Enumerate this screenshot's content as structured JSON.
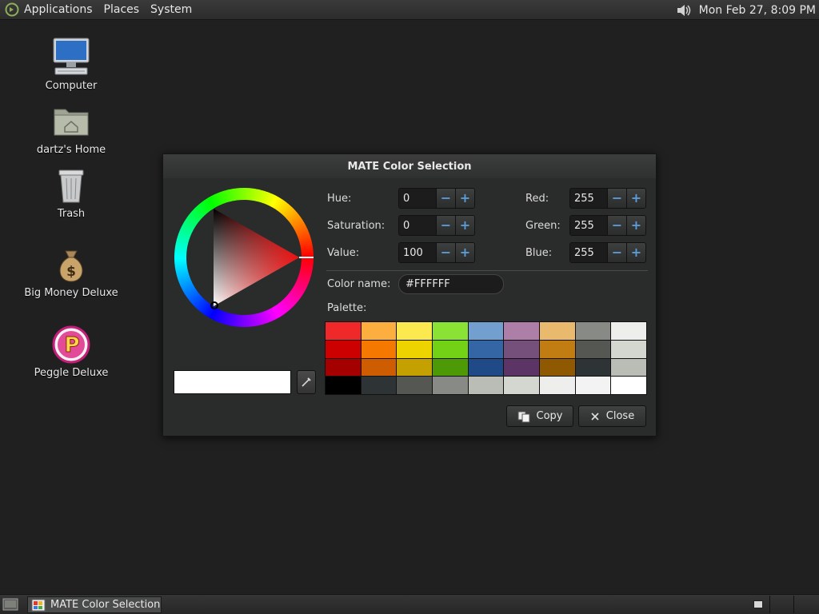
{
  "top_panel": {
    "menus": [
      "Applications",
      "Places",
      "System"
    ],
    "clock": "Mon Feb 27,  8:09 PM"
  },
  "desktop": {
    "icons": [
      {
        "label": "Computer",
        "icon": "computer-icon"
      },
      {
        "label": "dartz's Home",
        "icon": "home-folder-icon"
      },
      {
        "label": "Trash",
        "icon": "trash-icon"
      },
      {
        "label": "Big Money Deluxe",
        "icon": "money-bag-icon"
      },
      {
        "label": "Peggle Deluxe",
        "icon": "peggle-icon"
      }
    ]
  },
  "dialog": {
    "title": "MATE Color Selection",
    "fields": {
      "hue": {
        "label": "Hue:",
        "value": "0"
      },
      "saturation": {
        "label": "Saturation:",
        "value": "0"
      },
      "value": {
        "label": "Value:",
        "value": "100"
      },
      "red": {
        "label": "Red:",
        "value": "255"
      },
      "green": {
        "label": "Green:",
        "value": "255"
      },
      "blue": {
        "label": "Blue:",
        "value": "255"
      }
    },
    "color_name_label": "Color name:",
    "color_name_value": "#FFFFFF",
    "palette_label": "Palette:",
    "palette": [
      "#ef2929",
      "#fcaf3e",
      "#fce94f",
      "#8ae234",
      "#729fcf",
      "#ad7fa8",
      "#e9b96e",
      "#888a85",
      "#eeeeec",
      "#cc0000",
      "#f57900",
      "#edd400",
      "#73d216",
      "#3465a4",
      "#75507b",
      "#c17d11",
      "#555753",
      "#d3d7cf",
      "#a40000",
      "#ce5c00",
      "#c4a000",
      "#4e9a06",
      "#204a87",
      "#5c3566",
      "#8f5902",
      "#2e3436",
      "#babdb6",
      "#000000",
      "#2e3436",
      "#555753",
      "#888a85",
      "#babdb6",
      "#d3d7cf",
      "#eeeeec",
      "#f3f3f3",
      "#ffffff"
    ],
    "copy_label": "Copy",
    "close_label": "Close",
    "current_color": "#ffffff"
  },
  "taskbar": {
    "task_label": "MATE Color Selection"
  }
}
